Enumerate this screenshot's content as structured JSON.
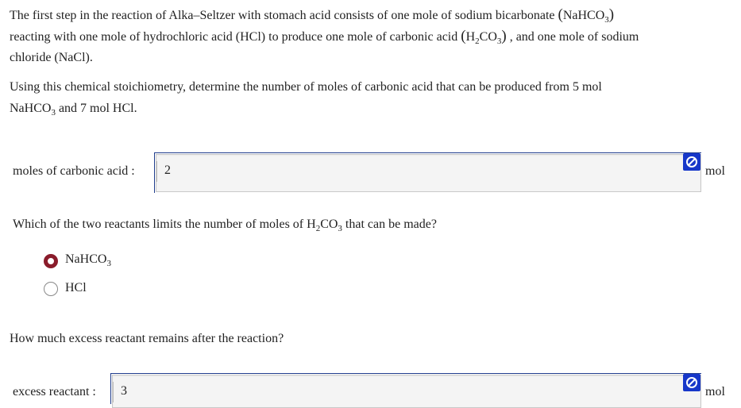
{
  "intro": {
    "line1_a": "The first step in the reaction of Alka–Seltzer with stomach acid consists of one mole of sodium bicarbonate ",
    "nahco3": "NaHCO",
    "sub3": "3",
    "line2_a": "reacting with one mole of hydrochloric acid ",
    "hcl_paren": "(HCl)",
    "line2_b": " to produce one mole of carbonic acid ",
    "h": "H",
    "sub2": "2",
    "co": "CO",
    "line2_c": ", and one mole of sodium",
    "line3": "chloride (NaCl).",
    "question_line1": "Using this chemical stoichiometry, determine the number of moles of carbonic acid that can be produced from 5 mol",
    "question_line2_a": "NaHCO",
    "question_line2_b": " and 7 mol HCl."
  },
  "q1": {
    "label": "moles of carbonic acid :",
    "value": "2",
    "unit": "mol"
  },
  "q2": {
    "prompt_a": "Which of the two reactants limits the number of moles of H",
    "prompt_b": "CO",
    "prompt_c": " that can be made?",
    "options": [
      {
        "label": "NaHCO",
        "sub": "3",
        "selected": true
      },
      {
        "label": "HCl",
        "sub": "",
        "selected": false
      }
    ]
  },
  "q3": {
    "prompt": "How much excess reactant remains after the reaction?",
    "label": "excess reactant :",
    "value": "3",
    "unit": "mol"
  },
  "colors": {
    "badge": "#1737c9",
    "radio_selected": "#8a1c2b",
    "field_border": "#1f3c8c"
  },
  "icons": {
    "field_badge": "no-entry-icon"
  }
}
